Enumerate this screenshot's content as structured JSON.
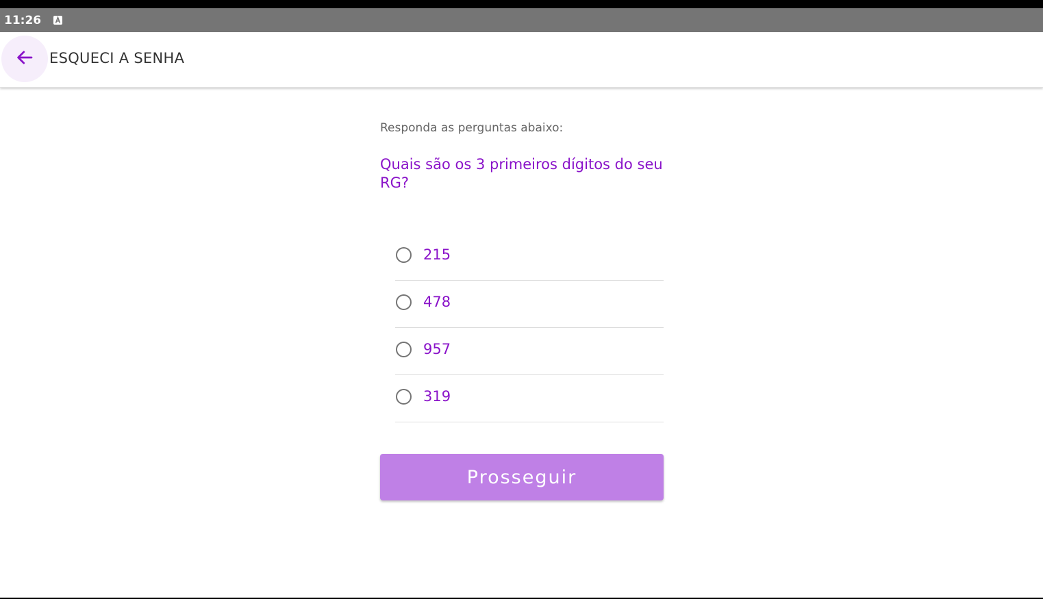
{
  "status_bar": {
    "time": "11:26",
    "notification_icon": "a-box-icon"
  },
  "app_bar": {
    "back_icon": "arrow-left-icon",
    "title": "ESQUECI A SENHA"
  },
  "form": {
    "instruction": "Responda as perguntas abaixo:",
    "question": "Quais são os 3 primeiros dígitos do seu RG?",
    "options": [
      {
        "label": "215",
        "selected": false
      },
      {
        "label": "478",
        "selected": false
      },
      {
        "label": "957",
        "selected": false
      },
      {
        "label": "319",
        "selected": false
      }
    ],
    "proceed_label": "Prosseguir"
  },
  "colors": {
    "accent": "#8a13c9",
    "button": "#bf80e6",
    "status_bar": "#757575"
  }
}
